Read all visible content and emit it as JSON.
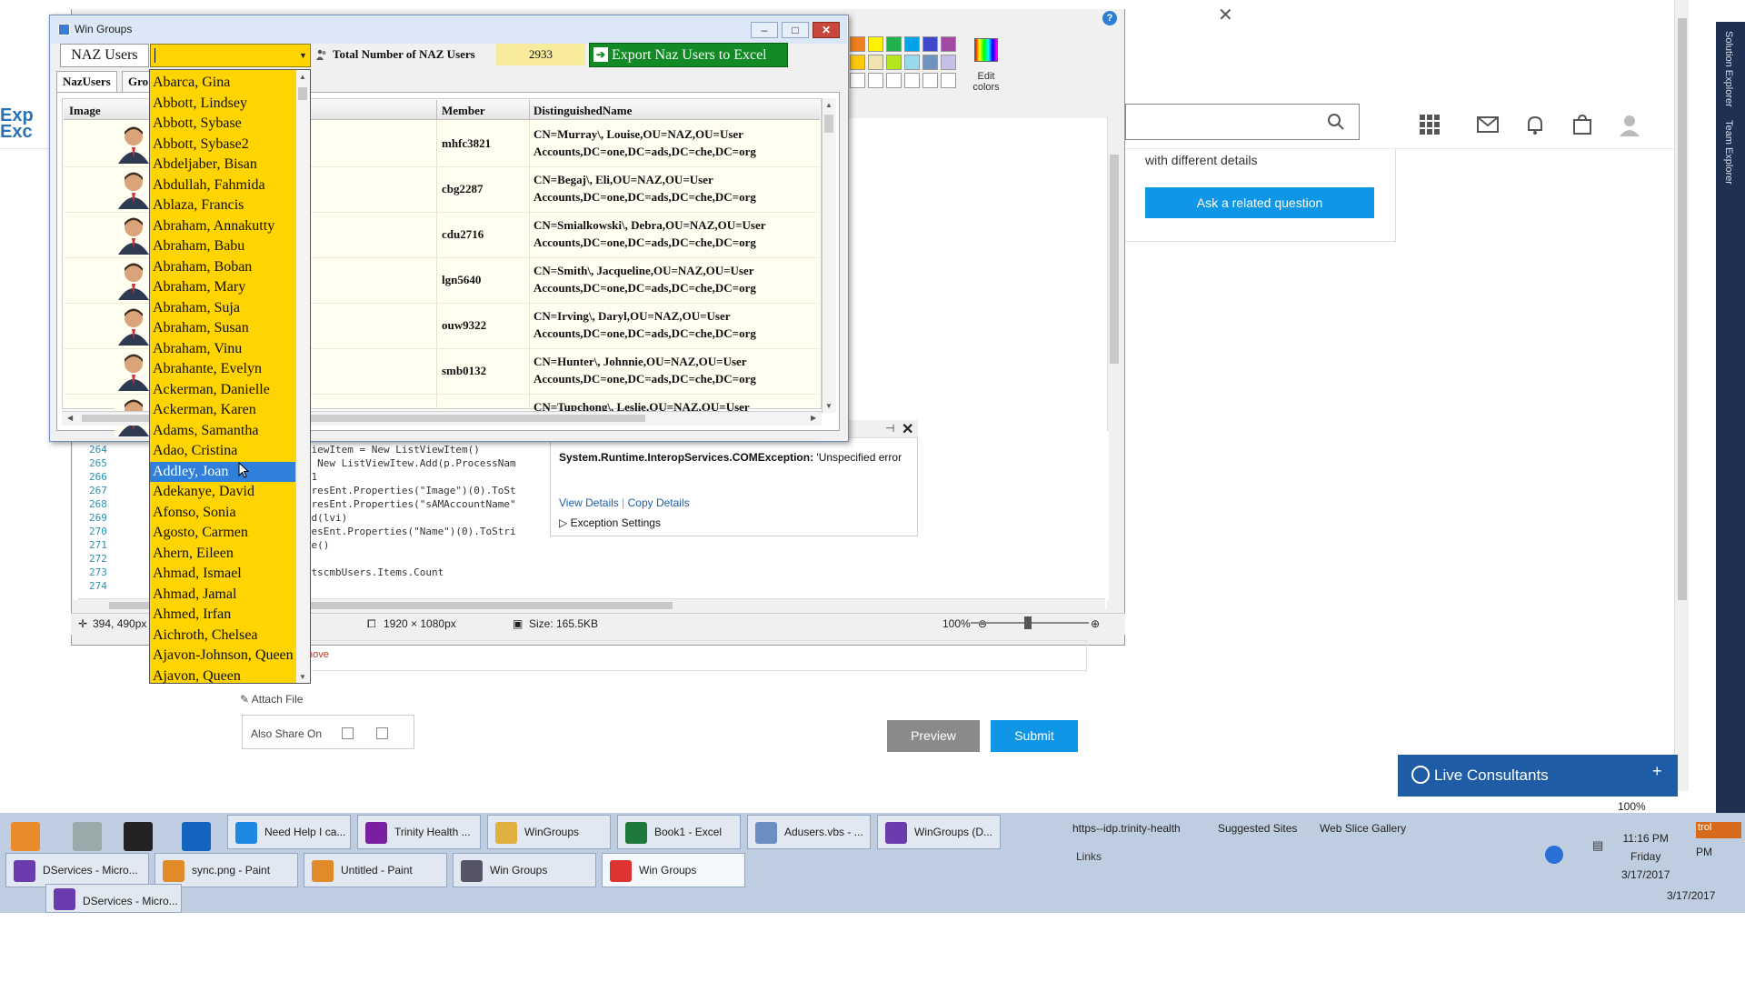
{
  "browser": {
    "close_glyph": "✕",
    "logo_text_1": "Exp",
    "logo_text_2": "Exc",
    "related_text": "with different details",
    "related_button": "Ask a related question",
    "header_icons": [
      "apps-grid-icon",
      "mail-icon",
      "bell-icon",
      "bag-icon",
      "user-icon"
    ]
  },
  "paint": {
    "edit_colors_label": "Edit colors",
    "status_position": "394, 490px",
    "status_dimensions": "1920 × 1080px",
    "status_size": "Size: 165.5KB",
    "zoom": "100%",
    "palette_row1": [
      "#f07f1f",
      "#fff200",
      "#22b14c",
      "#00a2e8",
      "#3f48cc",
      "#a349a4"
    ],
    "palette_row2": [
      "#ffc90e",
      "#efe4b0",
      "#b5e61d",
      "#99d9ea",
      "#7092be",
      "#c8bfe7"
    ]
  },
  "code": {
    "line_numbers": [
      "264",
      "265",
      "266",
      "267",
      "268",
      "269",
      "270",
      "271",
      "272",
      "273",
      "274"
    ],
    "lines": [
      "istViewItem = New ListViewItem()",
      "n As New ListViewItew.Add(p.ProcessNam",
      "k = 1",
      "Add(resEnt.Properties(\"Image\")(0).ToSt",
      "Add(resEnt.Properties(\"sAMAccountName\"",
      "s.Add(lvi)",
      "rt(resEnt.Properties(\"Name\")(0).ToStri",
      "pdate()",
      "",
      "t = tscmbUsers.Items.Count",
      ""
    ]
  },
  "exception": {
    "title_bold": "System.Runtime.InteropServices.COMException:",
    "title_rest": " 'Unspecified error",
    "view_details": "View Details",
    "copy_details": "Copy Details",
    "settings": "Exception Settings"
  },
  "form": {
    "remove": "nove",
    "attach": "Attach File",
    "share": "Also Share On",
    "preview": "Preview",
    "submit": "Submit"
  },
  "live_consultants": "Live Consultants",
  "zoom_status": "100%",
  "winGroups": {
    "title": "Win Groups",
    "naz_users_label": "NAZ Users",
    "combo_value": "",
    "total_label": "Total Number of NAZ Users",
    "total_value": "2933",
    "export_label": "Export Naz Users to Excel",
    "tabs": [
      "NazUsers",
      "Gro"
    ],
    "columns": [
      "Image",
      "Member",
      "DistinguishedName"
    ],
    "rows": [
      {
        "member": "mhfc3821",
        "dn1": "CN=Murray\\, Louise,OU=NAZ,OU=User",
        "dn2": "Accounts,DC=one,DC=ads,DC=che,DC=org"
      },
      {
        "member": "cbg2287",
        "dn1": "CN=Begaj\\, Eli,OU=NAZ,OU=User",
        "dn2": "Accounts,DC=one,DC=ads,DC=che,DC=org"
      },
      {
        "member": "cdu2716",
        "dn1": "CN=Smialkowski\\, Debra,OU=NAZ,OU=User",
        "dn2": "Accounts,DC=one,DC=ads,DC=che,DC=org"
      },
      {
        "member": "lgn5640",
        "dn1": "CN=Smith\\, Jacqueline,OU=NAZ,OU=User",
        "dn2": "Accounts,DC=one,DC=ads,DC=che,DC=org"
      },
      {
        "member": "ouw9322",
        "dn1": "CN=Irving\\, Daryl,OU=NAZ,OU=User",
        "dn2": "Accounts,DC=one,DC=ads,DC=che,DC=org"
      },
      {
        "member": "smb0132",
        "dn1": "CN=Hunter\\, Johnnie,OU=NAZ,OU=User",
        "dn2": "Accounts,DC=one,DC=ads,DC=che,DC=org"
      },
      {
        "member": "",
        "dn1": "CN=Tupchong\\, Leslie,OU=NAZ,OU=User",
        "dn2": ""
      }
    ],
    "dropdown_items": [
      "Abarca, Gina",
      "Abbott, Lindsey",
      "Abbott, Sybase",
      "Abbott, Sybase2",
      "Abdeljaber, Bisan",
      "Abdullah, Fahmida",
      "Ablaza, Francis",
      "Abraham, Annakutty",
      "Abraham, Babu",
      "Abraham, Boban",
      "Abraham, Mary",
      "Abraham, Suja",
      "Abraham, Susan",
      "Abraham, Vinu",
      "Abrahante, Evelyn",
      "Ackerman, Danielle",
      "Ackerman, Karen",
      "Adams, Samantha",
      "Adao, Cristina",
      "Addley, Joan",
      "Adekanye, David",
      "Afonso, Sonia",
      "Agosto, Carmen",
      "Ahern, Eileen",
      "Ahmad, Ismael",
      "Ahmad, Jamal",
      "Ahmed, Irfan",
      "Aichroth, Chelsea",
      "Ajavon-Johnson, Queen",
      "Ajavon, Queen"
    ],
    "selected_index": 19
  },
  "taskbar": {
    "row1": [
      "Need Help I ca...",
      "Trinity Health ...",
      "WinGroups",
      "Book1 - Excel",
      "Adusers.vbs - ...",
      "WinGroups (D..."
    ],
    "row2": [
      "DServices - Micro...",
      "sync.png - Paint",
      "Untitled - Paint",
      "Win Groups",
      "Win Groups"
    ],
    "row3": [
      "DServices - Micro..."
    ],
    "links": [
      "https--idp.trinity-health",
      "Suggested Sites",
      "Web Slice Gallery"
    ],
    "links_label": "Links",
    "time": "11:16 PM",
    "day": "Friday",
    "date": "3/17/2017",
    "date2": "3/17/2017",
    "pm_fragment": "PM",
    "ctl_fragment": "trol"
  },
  "side": {
    "solution_explorer": "Solution Explorer",
    "team_explorer": "Team Explorer"
  }
}
